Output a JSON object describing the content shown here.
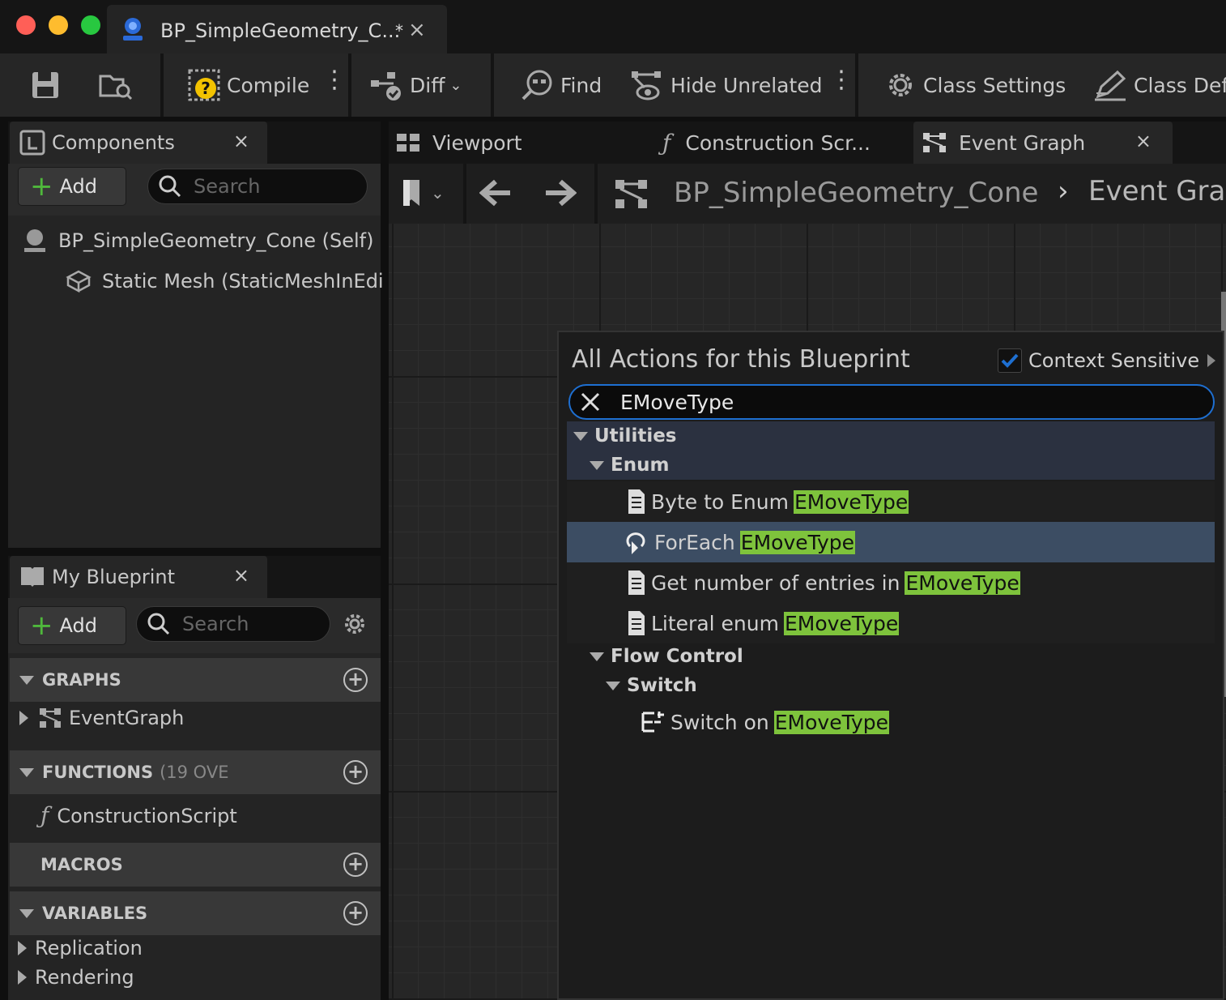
{
  "window": {
    "tab_title": "BP_SimpleGeometry_C...",
    "tab_modified": "*",
    "traffic_colors": {
      "close": "#ff5f57",
      "minimize": "#febc2e",
      "zoom": "#28c840"
    }
  },
  "toolbar": {
    "compile": "Compile",
    "diff": "Diff",
    "find": "Find",
    "hide_unrelated": "Hide Unrelated",
    "class_settings": "Class Settings",
    "class_defaults": "Class Defa"
  },
  "components": {
    "tab": "Components",
    "add": "Add",
    "search_placeholder": "Search",
    "root": "BP_SimpleGeometry_Cone (Self)",
    "child": "Static Mesh (StaticMeshInEdi"
  },
  "my_blueprint": {
    "tab": "My Blueprint",
    "add": "Add",
    "search_placeholder": "Search",
    "graphs": "GRAPHS",
    "eventgraph": "EventGraph",
    "functions": "FUNCTIONS",
    "functions_count": "(19 OVE",
    "construction": "ConstructionScript",
    "macros": "MACROS",
    "variables": "VARIABLES",
    "replication": "Replication",
    "rendering": "Rendering"
  },
  "graph_tabs": {
    "viewport": "Viewport",
    "construction": "Construction Scr...",
    "event_graph": "Event Graph"
  },
  "breadcrumb": {
    "blueprint": "BP_SimpleGeometry_Cone",
    "graph": "Event Gra"
  },
  "actions": {
    "title": "All Actions for this Blueprint",
    "context_sensitive": "Context Sensitive",
    "search_value": "EMoveType",
    "utilities": "Utilities",
    "enum": "Enum",
    "byte_to_enum": "Byte to Enum ",
    "foreach": "ForEach ",
    "get_number": "Get number of entries in ",
    "literal_enum": "Literal enum ",
    "flow_control": "Flow Control",
    "switch": "Switch",
    "switch_on": "Switch on ",
    "match": "EMoveType",
    "accent": "#1e6fd1",
    "highlight": "#7ec33c"
  }
}
